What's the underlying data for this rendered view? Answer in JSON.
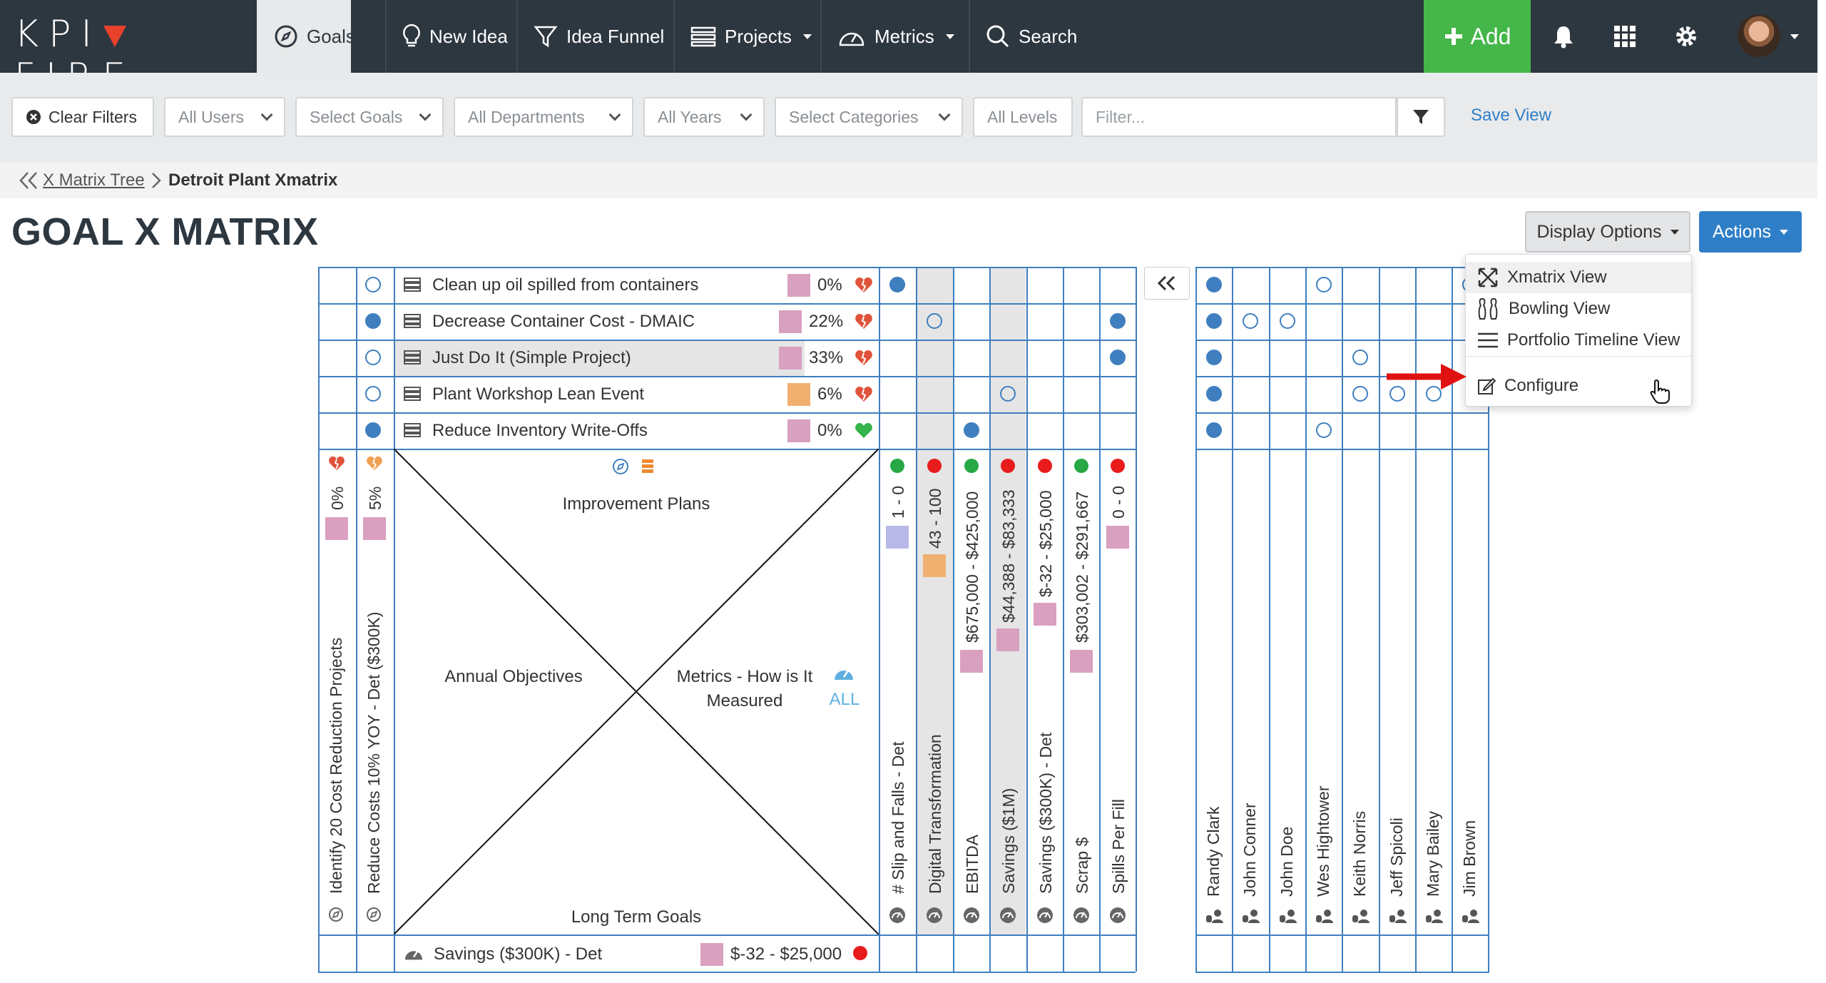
{
  "nav": {
    "logo": "KPIFIRE",
    "items": [
      {
        "label": "Goals"
      },
      {
        "label": "New Idea"
      },
      {
        "label": "Idea Funnel"
      },
      {
        "label": "Projects"
      },
      {
        "label": "Metrics"
      },
      {
        "label": "Search"
      }
    ],
    "add_label": "Add"
  },
  "filters": {
    "clear_label": "Clear Filters",
    "users": "All Users",
    "goals": "Select Goals",
    "departments": "All Departments",
    "years": "All Years",
    "categories": "Select Categories",
    "levels": "All Levels",
    "filter_placeholder": "Filter...",
    "save_view": "Save View"
  },
  "breadcrumb": {
    "parent": "X Matrix Tree",
    "current": "Detroit Plant Xmatrix"
  },
  "page_title": "GOAL X MATRIX",
  "toolbar": {
    "display_options": "Display Options",
    "actions": "Actions"
  },
  "dropdown": {
    "items": [
      "Xmatrix View",
      "Bowling View",
      "Portfolio Timeline View",
      "Configure"
    ]
  },
  "projects": [
    {
      "name": "Clean up oil spilled from containers",
      "pct": "0%",
      "swatch": "#d9a0c0",
      "health": "broken"
    },
    {
      "name": "Decrease Container Cost - DMAIC",
      "pct": "22%",
      "swatch": "#d9a0c0",
      "health": "broken"
    },
    {
      "name": "Just Do It (Simple Project)",
      "pct": "33%",
      "swatch": "#d9a0c0",
      "health": "broken"
    },
    {
      "name": "Plant Workshop Lean Event",
      "pct": "6%",
      "swatch": "#f0b070",
      "health": "broken"
    },
    {
      "name": "Reduce Inventory Write-Offs",
      "pct": "0%",
      "swatch": "#d9a0c0",
      "health": "good"
    }
  ],
  "annual_objectives": [
    {
      "name": "Identify 20 Cost Reduction Projects",
      "pct": "0%"
    },
    {
      "name": "Reduce Costs 10% YOY - Det ($300K)",
      "pct": "5%"
    }
  ],
  "center": {
    "top": "Improvement Plans",
    "left": "Annual Objectives",
    "right_line1": "Metrics - How is It",
    "right_line2": "Measured",
    "all": "ALL",
    "bottom": "Long Term Goals"
  },
  "metrics": [
    {
      "name": "# Slip and Falls - Det",
      "range": "1 - 0",
      "status": "#27a844"
    },
    {
      "name": "Digital Transformation",
      "range": "43 - 100",
      "status": "#e81c1c"
    },
    {
      "name": "EBITDA",
      "range": "$675,000 - $425,000",
      "status": "#27a844"
    },
    {
      "name": "Savings ($1M)",
      "range": "$44,388 - $83,333",
      "status": "#e81c1c"
    },
    {
      "name": "Savings ($300K) - Det",
      "range": "$-32 - $25,000",
      "status": "#e81c1c"
    },
    {
      "name": "Scrap $",
      "range": "$303,002 - $291,667",
      "status": "#27a844"
    },
    {
      "name": "Spills Per Fill",
      "range": "0 - 0",
      "status": "#e81c1c"
    }
  ],
  "people": [
    "Randy Clark",
    "John Conner",
    "John Doe",
    "Wes Hightower",
    "Keith Norris",
    "Jeff Spicoli",
    "Mary Bailey",
    "Jim Brown"
  ],
  "long_term_goal": {
    "name": "Savings ($300K) - Det",
    "range": "$-32 - $25,000"
  },
  "colors": {
    "nav_bg": "#2d3740",
    "accent": "#2f7fc8",
    "add_green": "#45b649",
    "grid": "#3f7fbf",
    "red": "#e81c1c",
    "green": "#27a844"
  }
}
